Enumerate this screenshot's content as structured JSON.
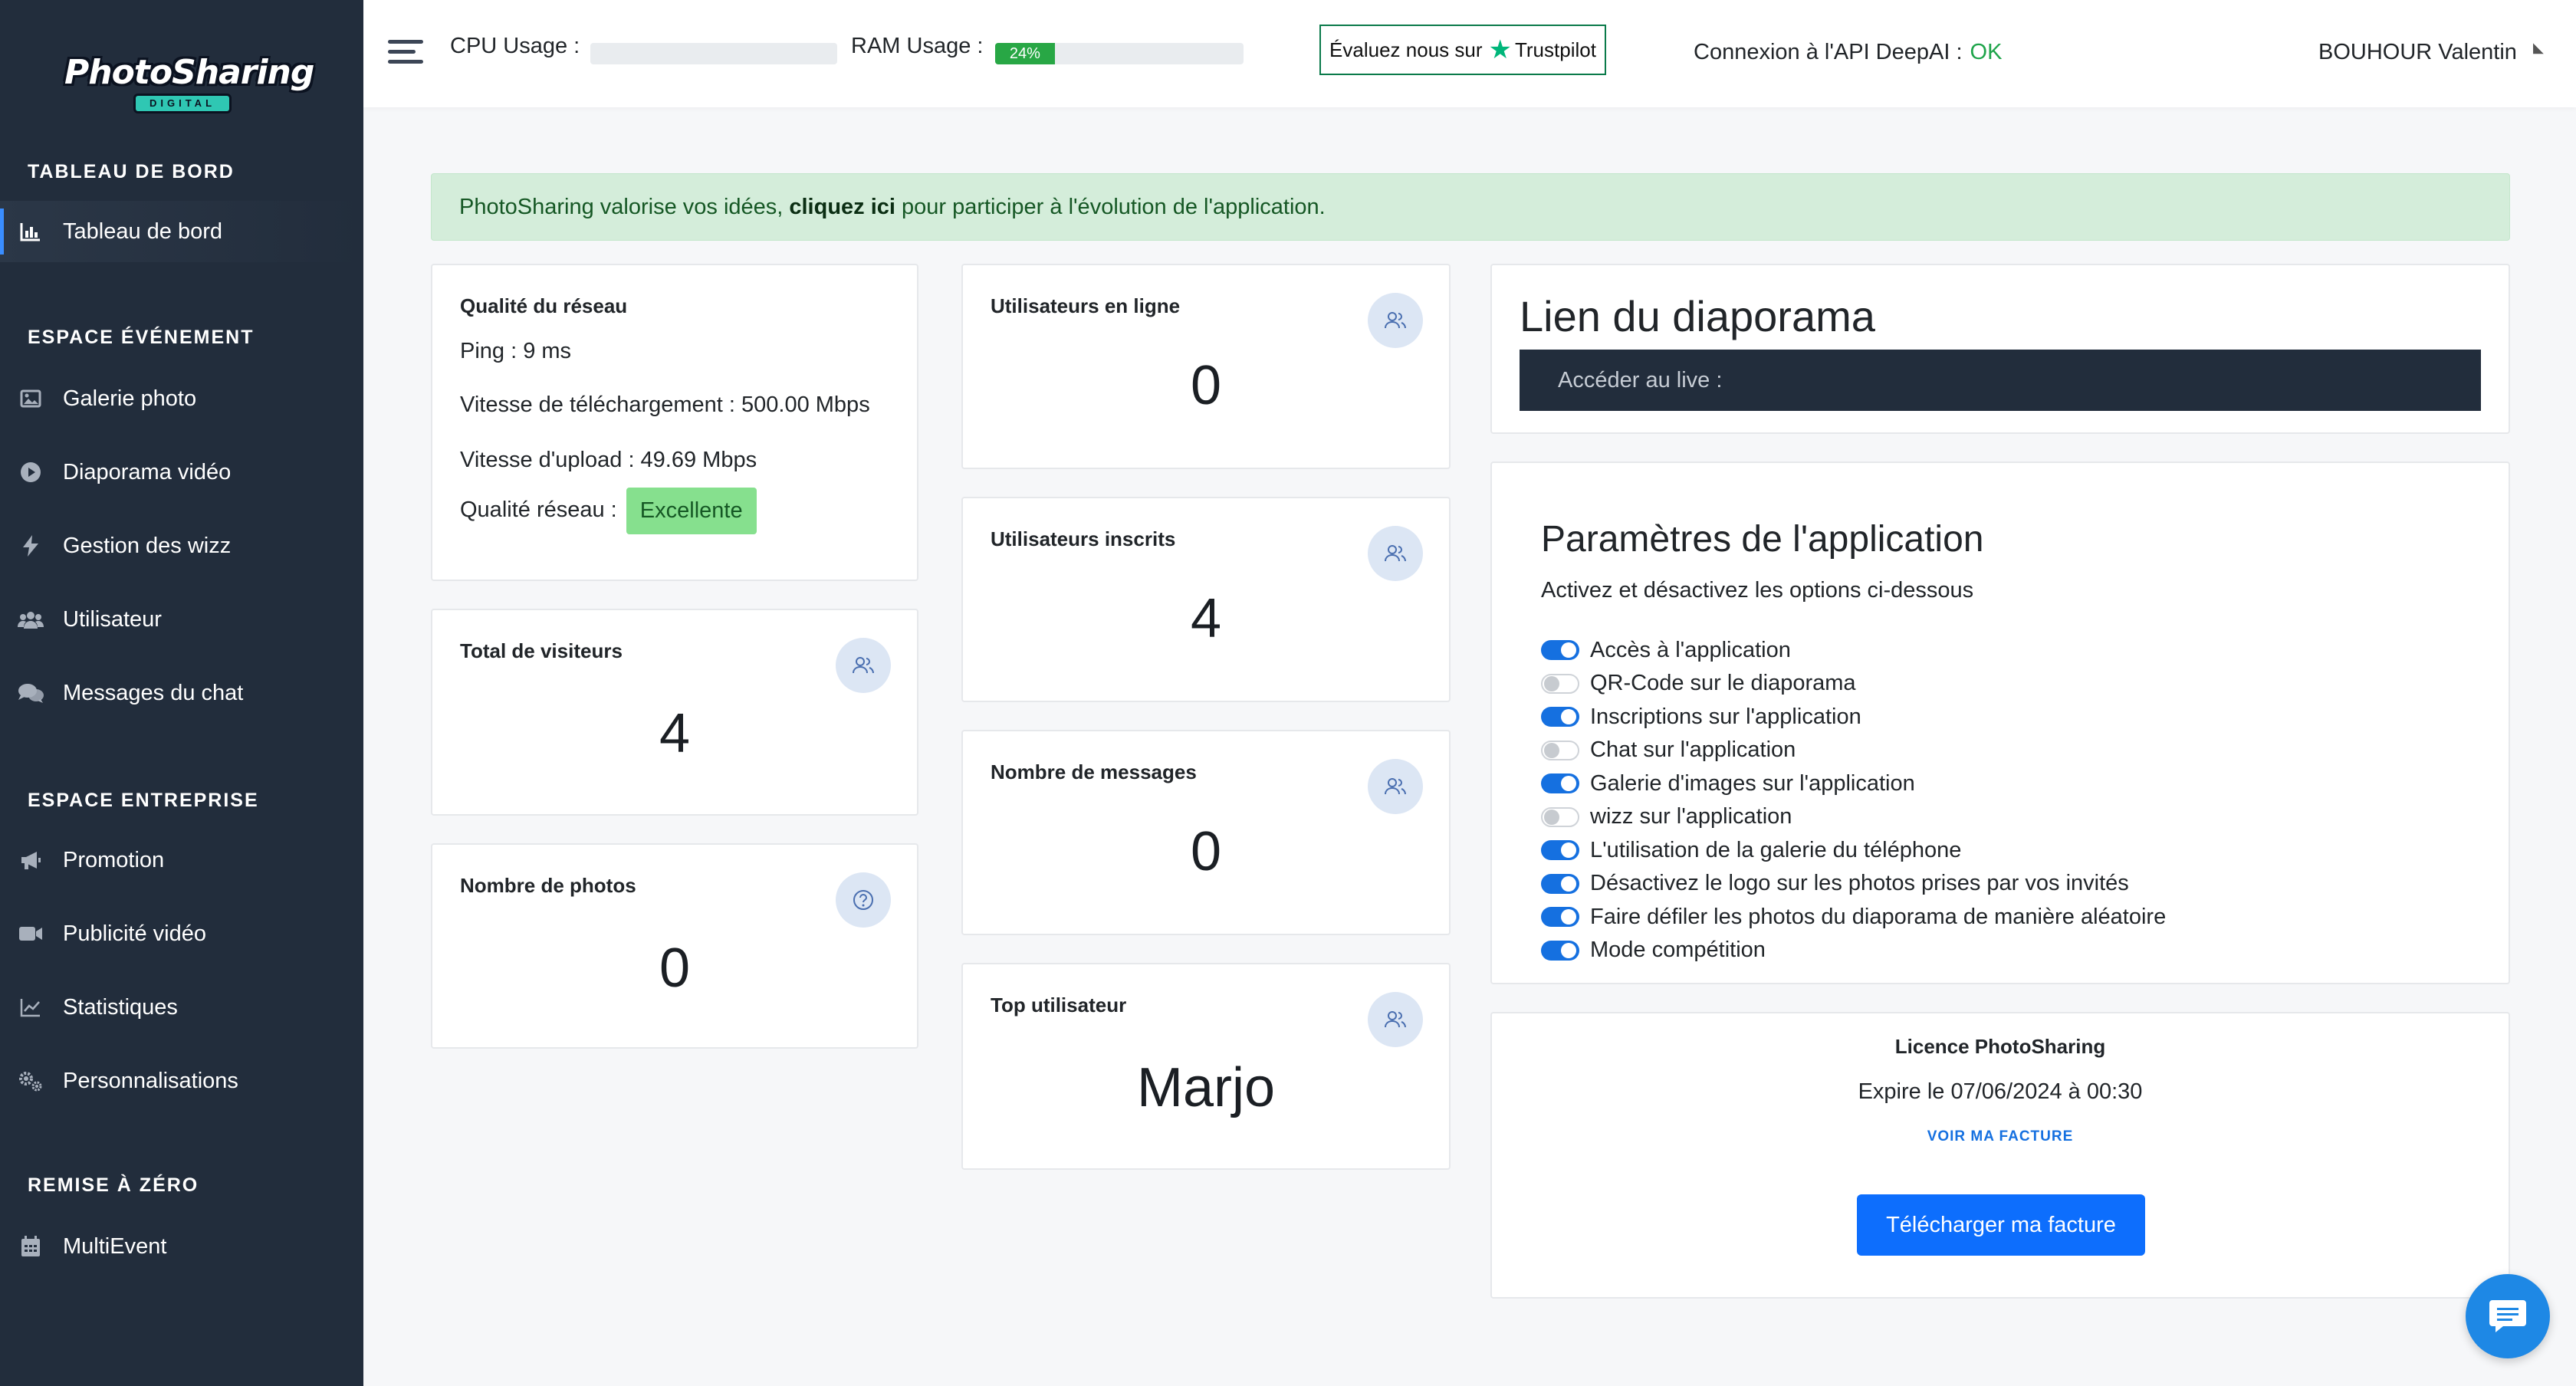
{
  "brand": {
    "name": "PhotoSharing",
    "sub": "DIGITAL"
  },
  "sidebar": {
    "sections": [
      {
        "title": "TABLEAU DE BORD"
      },
      {
        "title": "ESPACE ÉVÉNEMENT"
      },
      {
        "title": "ESPACE ENTREPRISE"
      },
      {
        "title": "REMISE À ZÉRO"
      }
    ],
    "items": [
      {
        "label": "Tableau de bord",
        "icon": "bar-chart-icon",
        "active": true
      },
      {
        "label": "Galerie photo",
        "icon": "image-icon"
      },
      {
        "label": "Diaporama vidéo",
        "icon": "play-circle-icon"
      },
      {
        "label": "Gestion des wizz",
        "icon": "bolt-icon"
      },
      {
        "label": "Utilisateur",
        "icon": "users-icon"
      },
      {
        "label": "Messages du chat",
        "icon": "chat-bubbles-icon"
      },
      {
        "label": "Promotion",
        "icon": "megaphone-icon"
      },
      {
        "label": "Publicité vidéo",
        "icon": "video-camera-icon"
      },
      {
        "label": "Statistiques",
        "icon": "line-chart-icon"
      },
      {
        "label": "Personnalisations",
        "icon": "gears-icon"
      },
      {
        "label": "MultiEvent",
        "icon": "calendar-icon"
      }
    ]
  },
  "topbar": {
    "cpu_label": "CPU Usage :",
    "cpu_value": 0,
    "ram_label": "RAM Usage :",
    "ram_value": 0.24,
    "ram_text": "24%",
    "trustpilot_prefix": "Évaluez nous sur",
    "trustpilot_brand": "Trustpilot",
    "api_label": "Connexion à l'API DeepAI :",
    "api_status": "OK",
    "user_name": "BOUHOUR Valentin"
  },
  "alert": {
    "text_before": "PhotoSharing valorise vos idées,",
    "link": "cliquez ici",
    "text_after": "pour participer à l'évolution de l'application."
  },
  "network": {
    "title": "Qualité du réseau",
    "ping": "Ping : 9 ms",
    "download": "Vitesse de téléchargement : 500.00 Mbps",
    "upload": "Vitesse d'upload : 49.69 Mbps",
    "quality_label": "Qualité réseau :",
    "quality_value": "Excellente"
  },
  "stats": {
    "visitors": {
      "title": "Total de visiteurs",
      "value": "4"
    },
    "photos": {
      "title": "Nombre de photos",
      "value": "0"
    },
    "online": {
      "title": "Utilisateurs en ligne",
      "value": "0"
    },
    "registered": {
      "title": "Utilisateurs inscrits",
      "value": "4"
    },
    "messages": {
      "title": "Nombre de messages",
      "value": "0"
    },
    "top_user": {
      "title": "Top utilisateur",
      "value": "Marjo"
    }
  },
  "diaporama": {
    "title": "Lien du diaporama",
    "live_label": "Accéder au live :"
  },
  "params": {
    "title": "Paramètres de l'application",
    "subtitle": "Activez et désactivez les options ci-dessous",
    "options": [
      {
        "label": "Accès à l'application",
        "on": true
      },
      {
        "label": "QR-Code sur le diaporama",
        "on": false
      },
      {
        "label": "Inscriptions sur l'application",
        "on": true
      },
      {
        "label": "Chat sur l'application",
        "on": false
      },
      {
        "label": "Galerie d'images sur l'application",
        "on": true
      },
      {
        "label": "wizz sur l'application",
        "on": false
      },
      {
        "label": "L'utilisation de la galerie du téléphone",
        "on": true
      },
      {
        "label": "Désactivez le logo sur les photos prises par vos invités",
        "on": true
      },
      {
        "label": "Faire défiler les photos du diaporama de manière aléatoire",
        "on": true
      },
      {
        "label": "Mode compétition",
        "on": true
      }
    ]
  },
  "license": {
    "title": "Licence PhotoSharing",
    "expires": "Expire le 07/06/2024 à 00:30",
    "invoice_link": "VOIR MA FACTURE",
    "download_button": "Télécharger ma facture"
  }
}
